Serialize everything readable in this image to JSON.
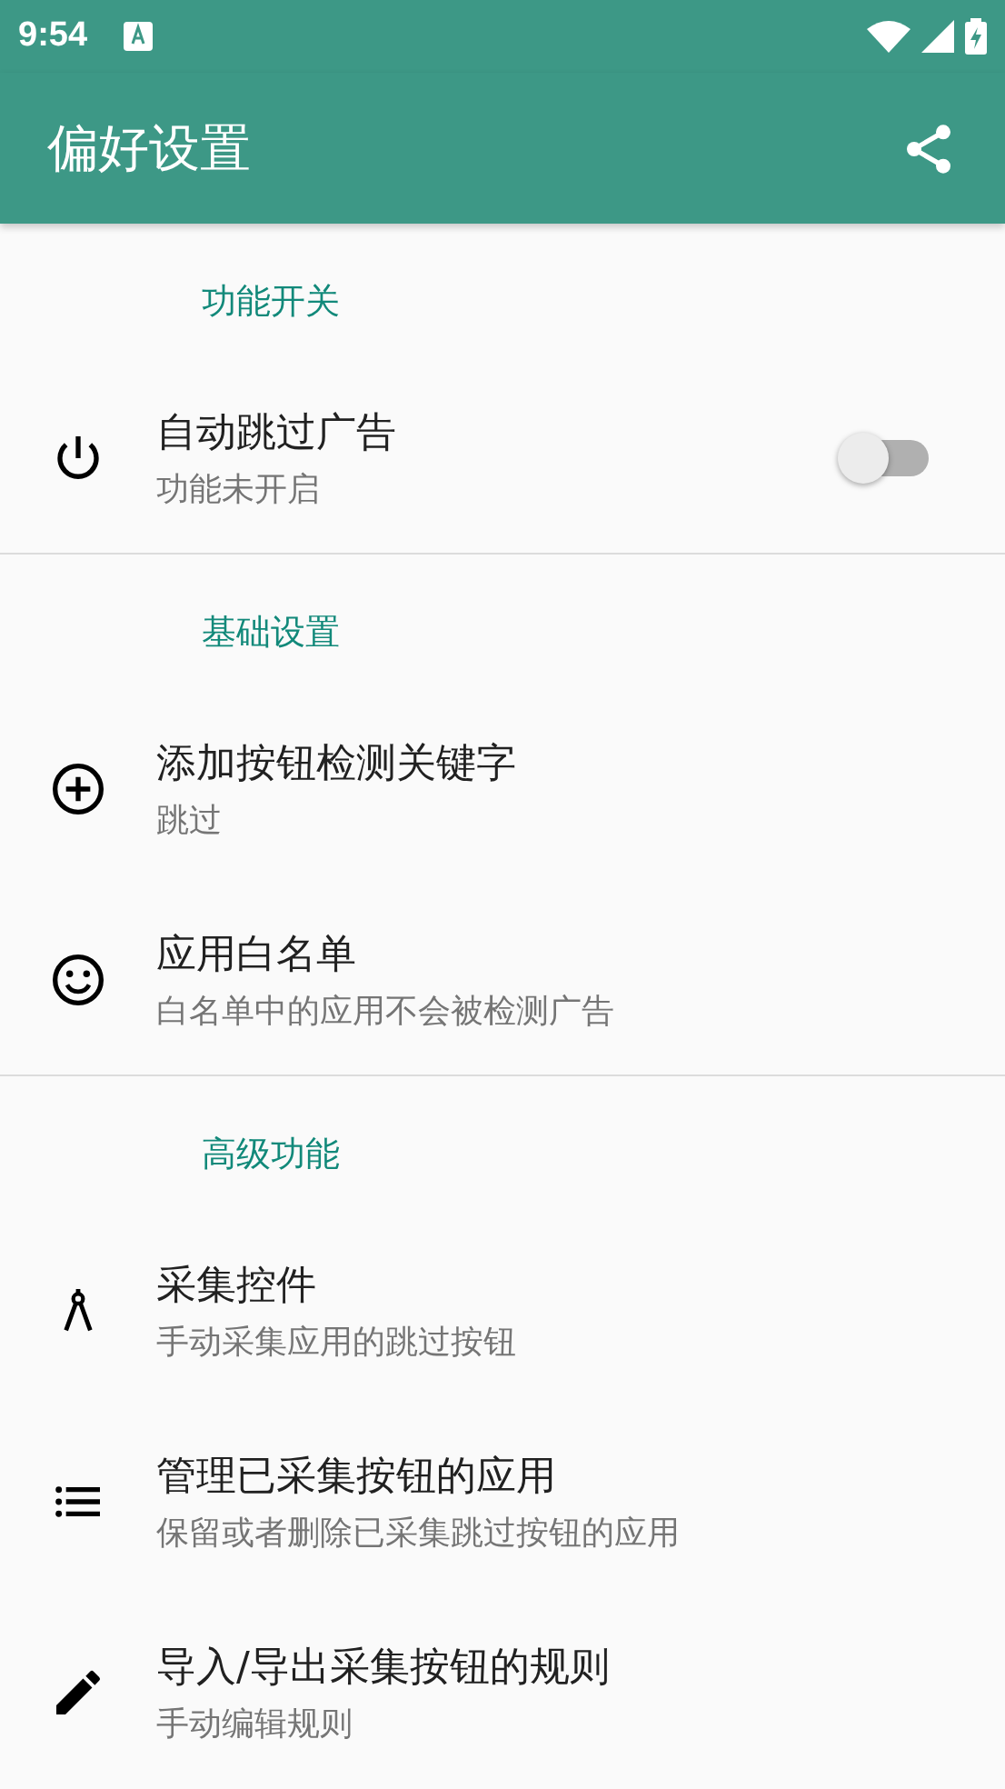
{
  "status_bar": {
    "time": "9:54"
  },
  "app_bar": {
    "title": "偏好设置"
  },
  "sections": [
    {
      "header": "功能开关",
      "items": [
        {
          "kind": "switch",
          "title": "自动跳过广告",
          "subtitle": "功能未开启",
          "on": false
        }
      ]
    },
    {
      "header": "基础设置",
      "items": [
        {
          "kind": "plain",
          "title": "添加按钮检测关键字",
          "subtitle": "跳过"
        },
        {
          "kind": "plain",
          "title": "应用白名单",
          "subtitle": "白名单中的应用不会被检测广告"
        }
      ]
    },
    {
      "header": "高级功能",
      "items": [
        {
          "kind": "plain",
          "title": "采集控件",
          "subtitle": "手动采集应用的跳过按钮"
        },
        {
          "kind": "plain",
          "title": "管理已采集按钮的应用",
          "subtitle": "保留或者删除已采集跳过按钮的应用"
        },
        {
          "kind": "plain",
          "title": "导入/导出采集按钮的规则",
          "subtitle": "手动编辑规则"
        }
      ]
    }
  ]
}
